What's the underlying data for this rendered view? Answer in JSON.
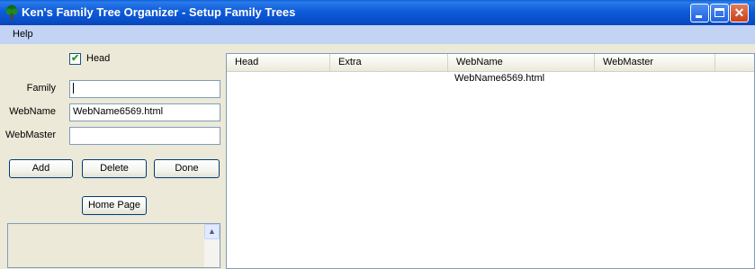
{
  "window": {
    "title": "Ken's Family Tree Organizer - Setup Family Trees",
    "icon": "tree-icon"
  },
  "menu": {
    "items": [
      {
        "label": "Help"
      }
    ]
  },
  "form": {
    "head_checkbox": {
      "label": "Head",
      "checked": true
    },
    "family": {
      "label": "Family",
      "value": ""
    },
    "webname": {
      "label": "WebName",
      "value": "WebName6569.html"
    },
    "webmaster": {
      "label": "WebMaster",
      "value": ""
    },
    "buttons": {
      "add": "Add",
      "delete": "Delete",
      "done": "Done",
      "home_page": "Home Page"
    }
  },
  "list": {
    "columns": [
      "Head",
      "Extra",
      "WebName",
      "WebMaster"
    ],
    "rows": [
      {
        "head": "",
        "extra": "",
        "webname": "WebName6569.html",
        "webmaster": ""
      }
    ]
  },
  "colors": {
    "titlebar": "#0A4FCB",
    "menubar": "#C2D3F3",
    "window_bg": "#ECE9D8"
  }
}
